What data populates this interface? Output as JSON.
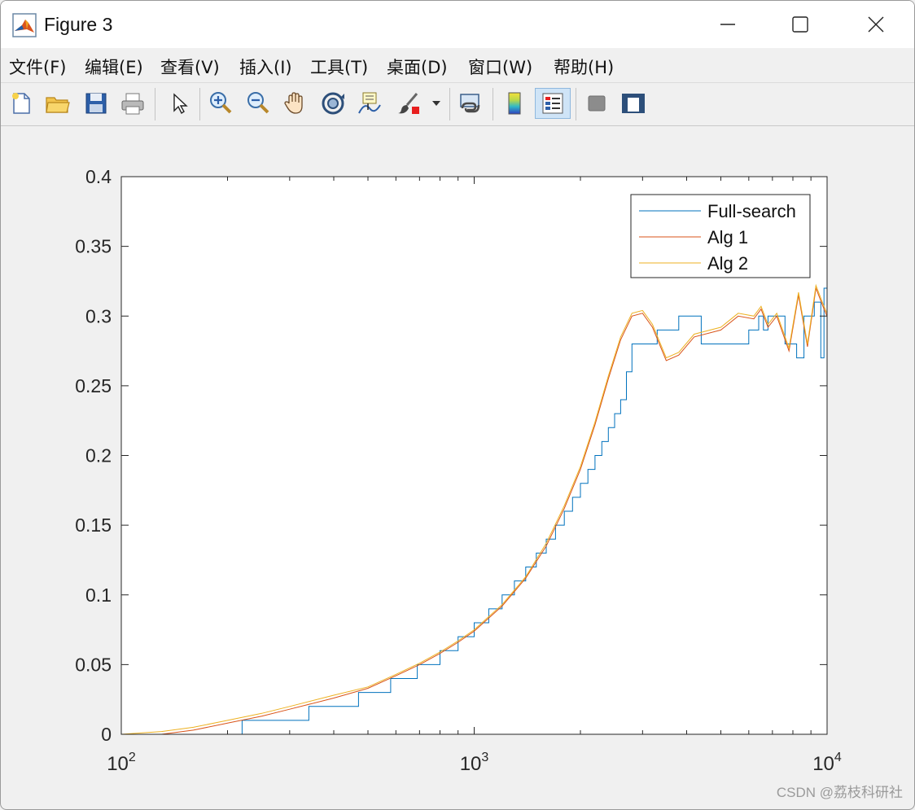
{
  "window": {
    "title": "Figure 3",
    "controls": [
      "minimize",
      "maximize",
      "close"
    ]
  },
  "menubar": {
    "items": [
      {
        "label": "文件(F)"
      },
      {
        "label": "编辑(E)"
      },
      {
        "label": "查看(V)"
      },
      {
        "label": "插入(I)"
      },
      {
        "label": "工具(T)"
      },
      {
        "label": "桌面(D)"
      },
      {
        "label": "窗口(W)"
      },
      {
        "label": "帮助(H)"
      }
    ]
  },
  "toolbar": {
    "icons": [
      "new-figure-icon",
      "open-file-icon",
      "save-icon",
      "print-icon",
      "select-arrow-icon",
      "zoom-in-icon",
      "zoom-out-icon",
      "pan-hand-icon",
      "rotate-3d-icon",
      "data-cursor-icon",
      "brush-icon",
      "brush-dropdown-icon",
      "link-plot-icon",
      "colorbar-icon",
      "legend-icon",
      "hide-plot-tools-icon",
      "show-plot-tools-icon"
    ]
  },
  "watermark": "CSDN @荔枝科研社",
  "chart_data": {
    "type": "line",
    "xscale": "log",
    "xlim": [
      100,
      10000
    ],
    "ylim": [
      0,
      0.4
    ],
    "xticks": [
      100,
      1000,
      10000
    ],
    "yticks": [
      0,
      0.05,
      0.1,
      0.15,
      0.2,
      0.25,
      0.3,
      0.35,
      0.4
    ],
    "yticklabels": [
      "0",
      "0.05",
      "0.1",
      "0.15",
      "0.2",
      "0.25",
      "0.3",
      "0.35",
      "0.4"
    ],
    "xticklabels": [
      {
        "base": "10",
        "exp": "2"
      },
      {
        "base": "10",
        "exp": "3"
      },
      {
        "base": "10",
        "exp": "4"
      }
    ],
    "legend": {
      "position": "top-right"
    },
    "series": [
      {
        "name": "Full-search",
        "color": "#0072BD",
        "step": true,
        "x": [
          100,
          150,
          220,
          340,
          470,
          580,
          690,
          800,
          900,
          1000,
          1100,
          1200,
          1300,
          1400,
          1500,
          1600,
          1700,
          1800,
          1900,
          2000,
          2100,
          2200,
          2300,
          2400,
          2500,
          2600,
          2700,
          2800,
          3300,
          3800,
          4400,
          5200,
          6000,
          6400,
          6600,
          6800,
          7600,
          8200,
          8600,
          9200,
          9600,
          9800,
          10000
        ],
        "y": [
          0,
          0,
          0.01,
          0.02,
          0.03,
          0.04,
          0.05,
          0.06,
          0.07,
          0.08,
          0.09,
          0.1,
          0.11,
          0.12,
          0.13,
          0.14,
          0.15,
          0.16,
          0.17,
          0.18,
          0.19,
          0.2,
          0.21,
          0.22,
          0.23,
          0.24,
          0.26,
          0.28,
          0.29,
          0.3,
          0.28,
          0.28,
          0.29,
          0.3,
          0.29,
          0.3,
          0.28,
          0.27,
          0.3,
          0.31,
          0.27,
          0.32,
          0.3
        ]
      },
      {
        "name": "Alg 1",
        "color": "#D95319",
        "x": [
          100,
          130,
          160,
          200,
          250,
          300,
          400,
          500,
          600,
          700,
          800,
          900,
          1000,
          1200,
          1400,
          1600,
          1800,
          2000,
          2200,
          2400,
          2600,
          2800,
          3000,
          3200,
          3500,
          3800,
          4200,
          5000,
          5600,
          6200,
          6500,
          6800,
          7200,
          7800,
          8300,
          8800,
          9300,
          9800,
          10000
        ],
        "y": [
          0,
          0,
          0.003,
          0.008,
          0.013,
          0.018,
          0.026,
          0.033,
          0.042,
          0.05,
          0.058,
          0.066,
          0.074,
          0.092,
          0.112,
          0.135,
          0.162,
          0.19,
          0.222,
          0.255,
          0.283,
          0.3,
          0.302,
          0.292,
          0.268,
          0.272,
          0.285,
          0.29,
          0.3,
          0.298,
          0.305,
          0.292,
          0.3,
          0.275,
          0.315,
          0.278,
          0.32,
          0.305,
          0.3
        ]
      },
      {
        "name": "Alg 2",
        "color": "#EDB120",
        "x": [
          100,
          130,
          160,
          200,
          250,
          300,
          400,
          500,
          600,
          700,
          800,
          900,
          1000,
          1200,
          1400,
          1600,
          1800,
          2000,
          2200,
          2400,
          2600,
          2800,
          3000,
          3200,
          3500,
          3800,
          4200,
          5000,
          5600,
          6200,
          6500,
          6800,
          7200,
          7800,
          8300,
          8800,
          9300,
          9800,
          10000
        ],
        "y": [
          0,
          0.002,
          0.005,
          0.01,
          0.015,
          0.02,
          0.028,
          0.034,
          0.043,
          0.051,
          0.059,
          0.067,
          0.075,
          0.093,
          0.113,
          0.137,
          0.164,
          0.192,
          0.224,
          0.257,
          0.285,
          0.302,
          0.304,
          0.294,
          0.27,
          0.274,
          0.287,
          0.292,
          0.302,
          0.3,
          0.307,
          0.294,
          0.302,
          0.277,
          0.317,
          0.28,
          0.322,
          0.307,
          0.302
        ]
      }
    ]
  }
}
